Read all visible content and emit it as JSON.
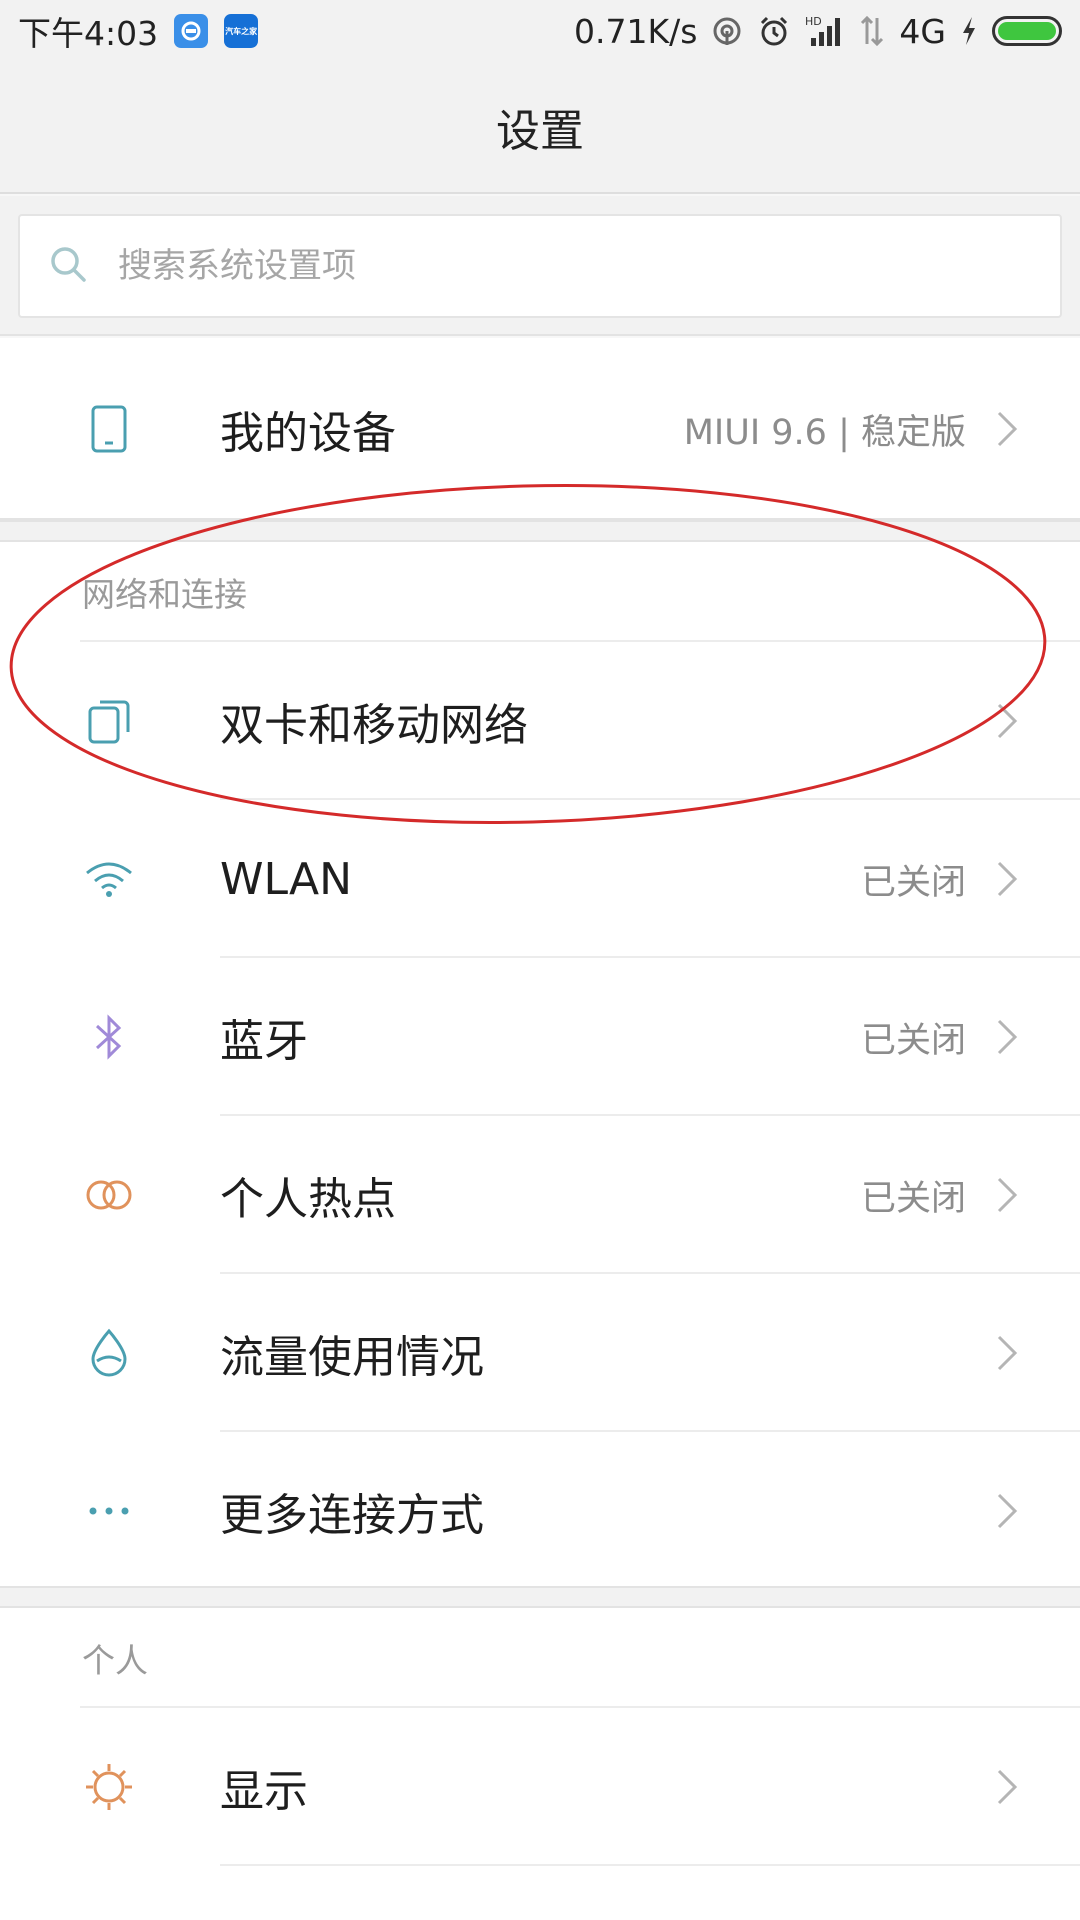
{
  "status_bar": {
    "time": "下午4:03",
    "network_speed": "0.71K/s",
    "network_type": "4G",
    "signal_hd": "HD",
    "car_app_label": "汽车之家",
    "icons": [
      "message-app-icon",
      "car-app-icon",
      "hotspot-status-icon",
      "alarm-icon",
      "signal-icon",
      "data-icon",
      "charging-icon",
      "battery-icon"
    ],
    "battery_level": 1.0,
    "battery_color": "#3fc63f"
  },
  "header": {
    "title": "设置"
  },
  "search": {
    "placeholder": "搜索系统设置项"
  },
  "device": {
    "label": "我的设备",
    "value": "MIUI 9.6 | 稳定版",
    "icon": "phone-icon"
  },
  "network_section": {
    "title": "网络和连接",
    "items": [
      {
        "label": "双卡和移动网络",
        "value": "",
        "icon": "dual-sim-icon"
      },
      {
        "label": "WLAN",
        "value": "已关闭",
        "icon": "wifi-icon"
      },
      {
        "label": "蓝牙",
        "value": "已关闭",
        "icon": "bluetooth-icon"
      },
      {
        "label": "个人热点",
        "value": "已关闭",
        "icon": "hotspot-icon"
      },
      {
        "label": "流量使用情况",
        "value": "",
        "icon": "data-usage-icon"
      },
      {
        "label": "更多连接方式",
        "value": "",
        "icon": "more-icon"
      }
    ]
  },
  "personal_section": {
    "title": "个人",
    "items": [
      {
        "label": "显示",
        "value": "",
        "icon": "brightness-icon"
      }
    ]
  },
  "colors": {
    "annotation": "#d42a2a",
    "icon_teal": "#4a9fb0",
    "icon_bluetooth": "#a08ad8",
    "icon_hotspot": "#e0925c",
    "icon_display": "#e0925c"
  }
}
